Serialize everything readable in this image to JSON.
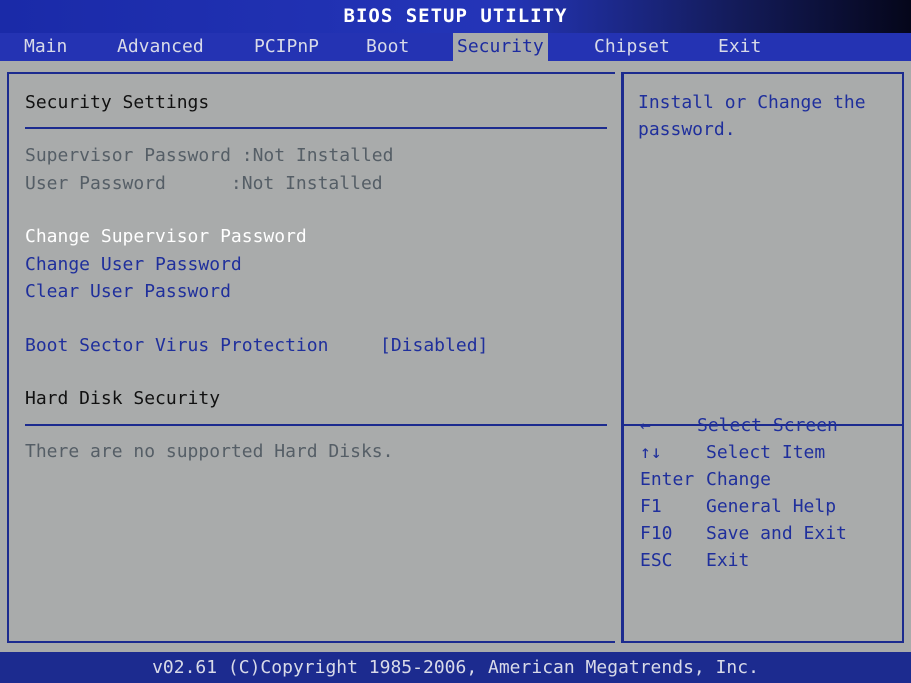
{
  "title": "BIOS SETUP UTILITY",
  "menu": {
    "tabs": [
      {
        "label": "Main"
      },
      {
        "label": "Advanced"
      },
      {
        "label": "PCIPnP"
      },
      {
        "label": "Boot"
      },
      {
        "label": "Security"
      },
      {
        "label": "Chipset"
      },
      {
        "label": "Exit"
      }
    ],
    "active_tab": "Security"
  },
  "left": {
    "heading": "Security Settings",
    "supervisor_password": "Supervisor Password :Not Installed",
    "user_password": "User Password      :Not Installed",
    "change_supervisor": "Change Supervisor Password",
    "change_user": "Change User Password",
    "clear_user": "Clear User Password",
    "boot_sector_label": "Boot Sector Virus Protection",
    "boot_sector_value": "[Disabled]",
    "hdd_heading": "Hard Disk Security",
    "hdd_message": "There are no supported Hard Disks."
  },
  "right": {
    "help_text_1": "Install or Change the",
    "help_text_2": "password.",
    "keys": [
      {
        "key": "←",
        "action": "Select Screen"
      },
      {
        "key": "↑↓",
        "action": "Select Item"
      },
      {
        "key": "Enter",
        "action": "Change"
      },
      {
        "key": "F1",
        "action": "General Help"
      },
      {
        "key": "F10",
        "action": "Save and Exit"
      },
      {
        "key": "ESC",
        "action": "Exit"
      }
    ]
  },
  "footer": "v02.61 (C)Copyright 1985-2006, American Megatrends, Inc.",
  "colors": {
    "frame_blue": "#1c2b8f",
    "panel_gray": "#a9abab",
    "selected_white": "#ffffff",
    "item_blue": "#1f2f9c"
  }
}
